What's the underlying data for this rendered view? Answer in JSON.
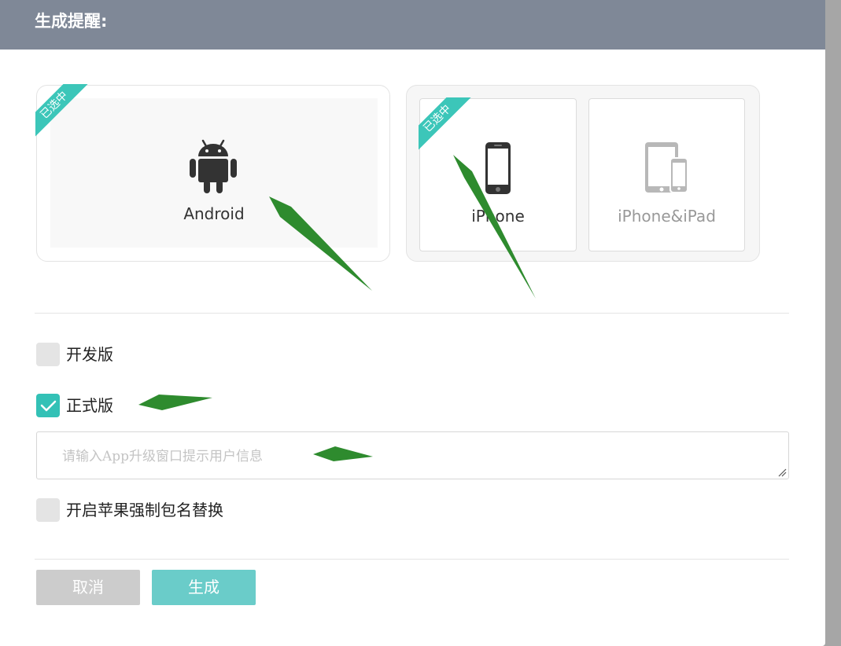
{
  "header": {
    "title": "生成提醒:"
  },
  "platforms": {
    "android": {
      "label": "Android",
      "badge": "已选中",
      "icon": "android-icon"
    },
    "ios": {
      "iphone": {
        "label": "iPhone",
        "badge": "已选中",
        "icon": "iphone-icon"
      },
      "ipad": {
        "label": "iPhone&iPad",
        "icon": "iphone-ipad-icon"
      }
    }
  },
  "options": {
    "dev": {
      "label": "开发版",
      "checked": false
    },
    "release": {
      "label": "正式版",
      "checked": true
    },
    "upgrade_message": {
      "placeholder": "请输入App升级窗口提示用户信息",
      "value": ""
    },
    "apple_package": {
      "label": "开启苹果强制包名替换",
      "checked": false
    }
  },
  "footer": {
    "cancel_label": "取消",
    "generate_label": "生成"
  },
  "colors": {
    "header_bg": "#7f8897",
    "accent": "#3cc6b9",
    "generate_button": "#6accc9",
    "cancel_button": "#cccccc",
    "annotation_arrow": "#2e8b2e"
  }
}
